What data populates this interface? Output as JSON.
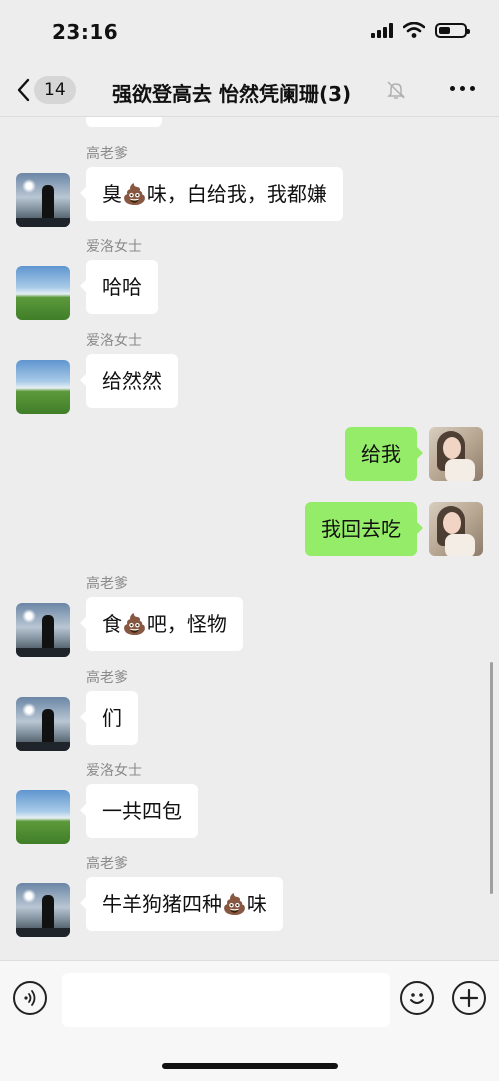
{
  "status_bar": {
    "time": "23:16"
  },
  "header": {
    "unread_count": "14",
    "title": "强欲登高去 怡然凭阑珊(3)"
  },
  "messages": [
    {
      "sender": "高老爹",
      "text": "臭💩味，白给我，我都嫌"
    },
    {
      "sender": "爱洛女士",
      "text": "哈哈"
    },
    {
      "sender": "爱洛女士",
      "text": "给然然"
    },
    {
      "text": "给我"
    },
    {
      "text": "我回去吃"
    },
    {
      "sender": "高老爹",
      "text": "食💩吧，怪物"
    },
    {
      "sender": "高老爹",
      "text": "们"
    },
    {
      "sender": "爱洛女士",
      "text": "一共四包"
    },
    {
      "sender": "高老爹",
      "text": "牛羊狗猪四种💩味"
    }
  ],
  "colors": {
    "outgoing_bubble": "#95ec69",
    "incoming_bubble": "#ffffff",
    "background": "#ededed"
  }
}
